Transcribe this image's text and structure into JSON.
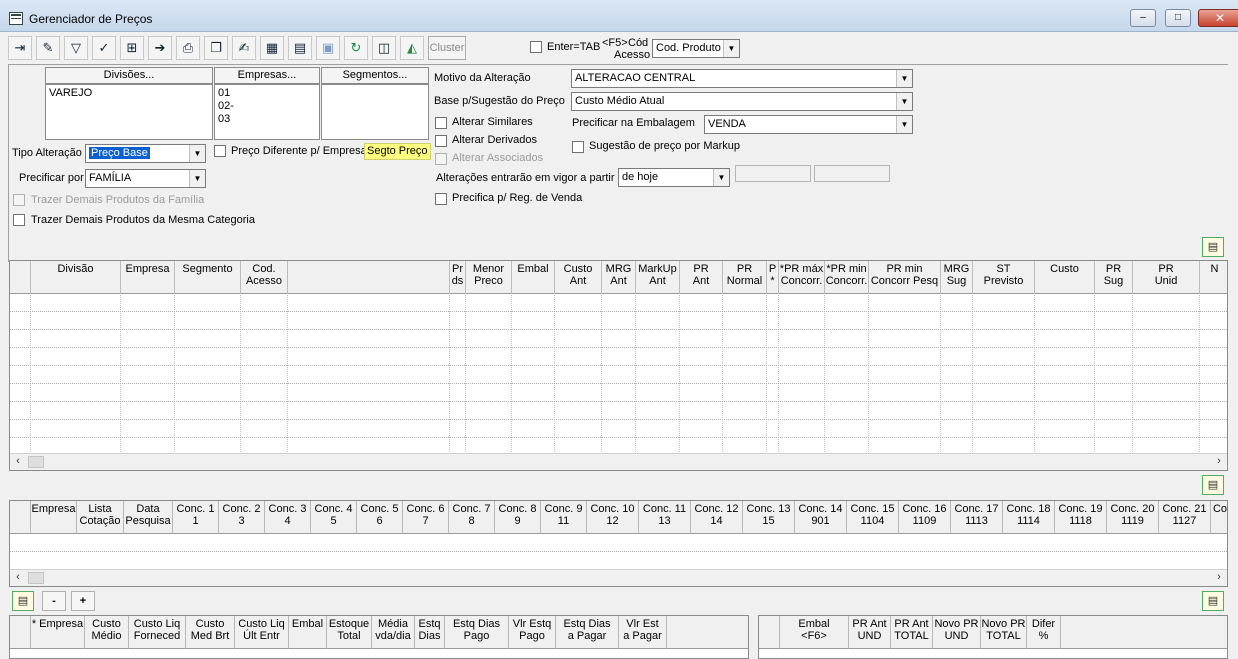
{
  "window": {
    "title": "Gerenciador de Preços",
    "controls": [
      "–",
      "□",
      "✕"
    ]
  },
  "toolbar": {
    "icons": [
      "exit-icon",
      "eraser-icon",
      "filter-icon",
      "filter-check-icon",
      "insert-icon",
      "export-icon",
      "print-icon",
      "copy-icon",
      "edit-check-icon",
      "grid-add-icon",
      "grid-icon",
      "save-icon",
      "refresh-icon",
      "report-icon",
      "chart-icon"
    ],
    "cluster_label": "Cluster",
    "enter_tab_label": "Enter=TAB",
    "f5_label": "<F5>",
    "cod_acesso_line1": "Cód",
    "cod_acesso_line2": "Acesso",
    "cod_select": "Cod. Produto"
  },
  "filters": {
    "divisoes_label": "Divisões...",
    "empresas_label": "Empresas...",
    "segmentos_label": "Segmentos...",
    "divisoes_items": [
      "VAREJO"
    ],
    "empresas_items": [
      "01",
      "02-",
      "03"
    ],
    "tipo_alteracao_label": "Tipo Alteração",
    "tipo_alteracao_value": "Preço Base",
    "preco_diferente_label": "Preço Diferente p/ Empresa",
    "segto_preco_label": "Segto Preço",
    "precificar_por_label": "Precificar por",
    "precificar_por_value": "FAMÍLIA",
    "trazer_familia_label": "Trazer Demais Produtos da Família",
    "trazer_categoria_label": "Trazer Demais Produtos da Mesma Categoria",
    "motivo_label": "Motivo da Alteração",
    "motivo_value": "ALTERACAO CENTRAL",
    "base_label": "Base p/Sugestão do Preço",
    "base_value": "Custo Médio Atual",
    "alterar_similares": "Alterar Similares",
    "alterar_derivados": "Alterar Derivados",
    "alterar_associados": "Alterar Associados",
    "precificar_embalagem_label": "Precificar na Embalagem",
    "precificar_embalagem_value": "VENDA",
    "sugestao_markup": "Sugestão de preço por Markup",
    "vigor_label": "Alterações entrarão em vigor a partir",
    "vigor_value": "de hoje",
    "precifica_reg_venda": "Precifica p/ Reg. de Venda"
  },
  "grid_main": {
    "columns": [
      "",
      "Divisão",
      "Empresa",
      "Segmento",
      "Cod.\nAcesso",
      "",
      "Pr\nds",
      "Menor\nPreco",
      "Embal",
      "Custo\nAnt",
      "MRG\nAnt",
      "MarkUp\nAnt",
      "PR\nAnt",
      "PR\nNormal",
      "P\n*",
      "*PR máx\nConcorr.",
      "*PR min\nConcorr.",
      "PR min\nConcorr Pesq",
      "MRG\nSug",
      "ST\nPrevisto",
      "Custo",
      "PR Sug",
      "PR\nUnid",
      "N"
    ]
  },
  "grid_conc": {
    "columns": [
      "",
      "Empresa",
      "Lista\nCotação",
      "Data\nPesquisa",
      "Conc. 1\n1",
      "Conc. 2\n3",
      "Conc. 3\n4",
      "Conc. 4\n5",
      "Conc. 5\n6",
      "Conc. 6\n7",
      "Conc. 7\n8",
      "Conc. 8\n9",
      "Conc. 9\n11",
      "Conc. 10\n12",
      "Conc. 11\n13",
      "Conc. 12\n14",
      "Conc. 13\n15",
      "Conc. 14\n901",
      "Conc. 15\n1104",
      "Conc. 16\n1109",
      "Conc. 17\n1113",
      "Conc. 18\n1114",
      "Conc. 19\n1118",
      "Conc. 20\n1119",
      "Conc. 21\n1127",
      "Co"
    ]
  },
  "bottom_buttons": [
    "-",
    "+"
  ],
  "grid_stock": {
    "columns": [
      "",
      "* Empresa",
      "Custo\nMédio",
      "Custo Liq\nForneced",
      "Custo\nMed Brt",
      "Custo Liq\nÚlt Entr",
      "Embal",
      "Estoque\nTotal",
      "Média\nvda/dia",
      "Estq\nDias",
      "Estq Dias\nPago",
      "Vlr Estq\nPago",
      "Estq Dias\na Pagar",
      "Vlr Est\na Pagar"
    ]
  },
  "grid_emb": {
    "columns": [
      "",
      "Embal\n<F6>",
      "PR Ant\nUND",
      "PR Ant\nTOTAL",
      "Novo PR\nUND",
      "Novo PR\nTOTAL",
      "Difer\n%"
    ]
  }
}
